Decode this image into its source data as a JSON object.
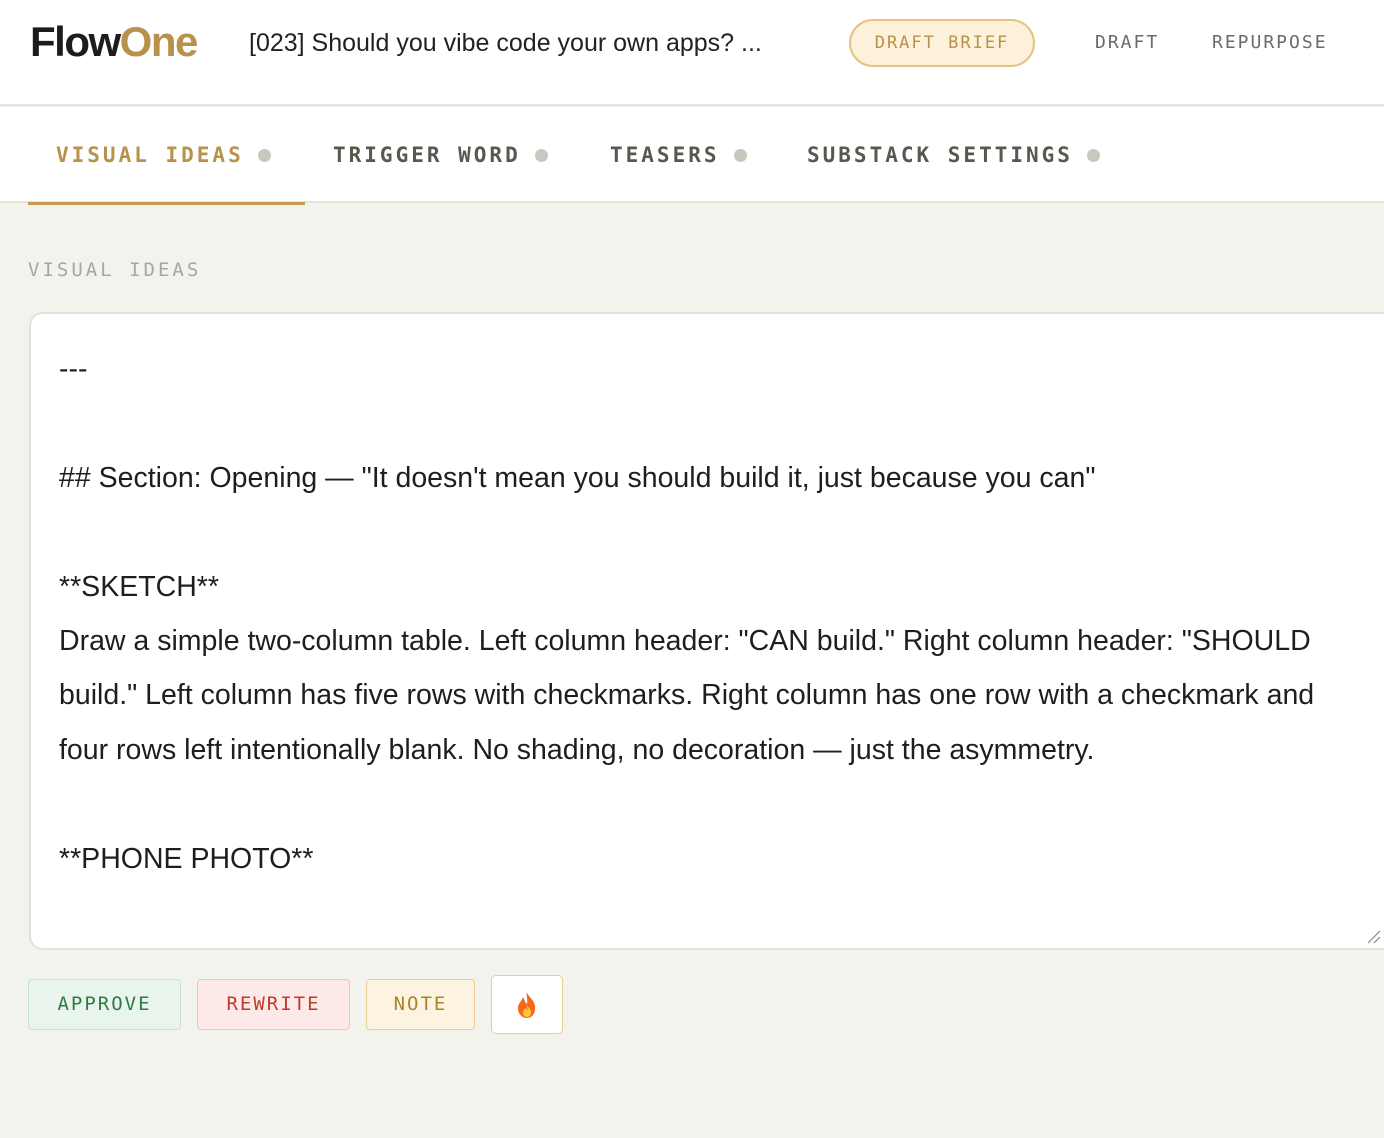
{
  "header": {
    "logo_part1": "Flow",
    "logo_part2": "One",
    "doc_title": "[023] Should you vibe code your own apps? ...",
    "status_pill": "DRAFT BRIEF",
    "nav": {
      "draft": "DRAFT",
      "repurpose": "REPURPOSE"
    }
  },
  "tabs": [
    {
      "label": "VISUAL IDEAS",
      "active": true
    },
    {
      "label": "TRIGGER WORD",
      "active": false
    },
    {
      "label": "TEASERS",
      "active": false
    },
    {
      "label": "SUBSTACK SETTINGS",
      "active": false
    }
  ],
  "main": {
    "section_label": "VISUAL IDEAS",
    "editor_text": "---\n\n## Section: Opening — \"It doesn't mean you should build it, just because you can\"\n\n**SKETCH**\nDraw a simple two-column table. Left column header: \"CAN build.\" Right column header: \"SHOULD build.\" Left column has five rows with checkmarks. Right column has one row with a checkmark and four rows left intentionally blank. No shading, no decoration — just the asymmetry.\n\n**PHONE PHOTO**"
  },
  "actions": {
    "approve": "APPROVE",
    "rewrite": "REWRITE",
    "note": "NOTE",
    "fire_icon": "fire-icon"
  },
  "colors": {
    "accent": "#b8914a",
    "approve": "#2f7a44",
    "rewrite": "#c0392b",
    "note": "#a8842f"
  }
}
